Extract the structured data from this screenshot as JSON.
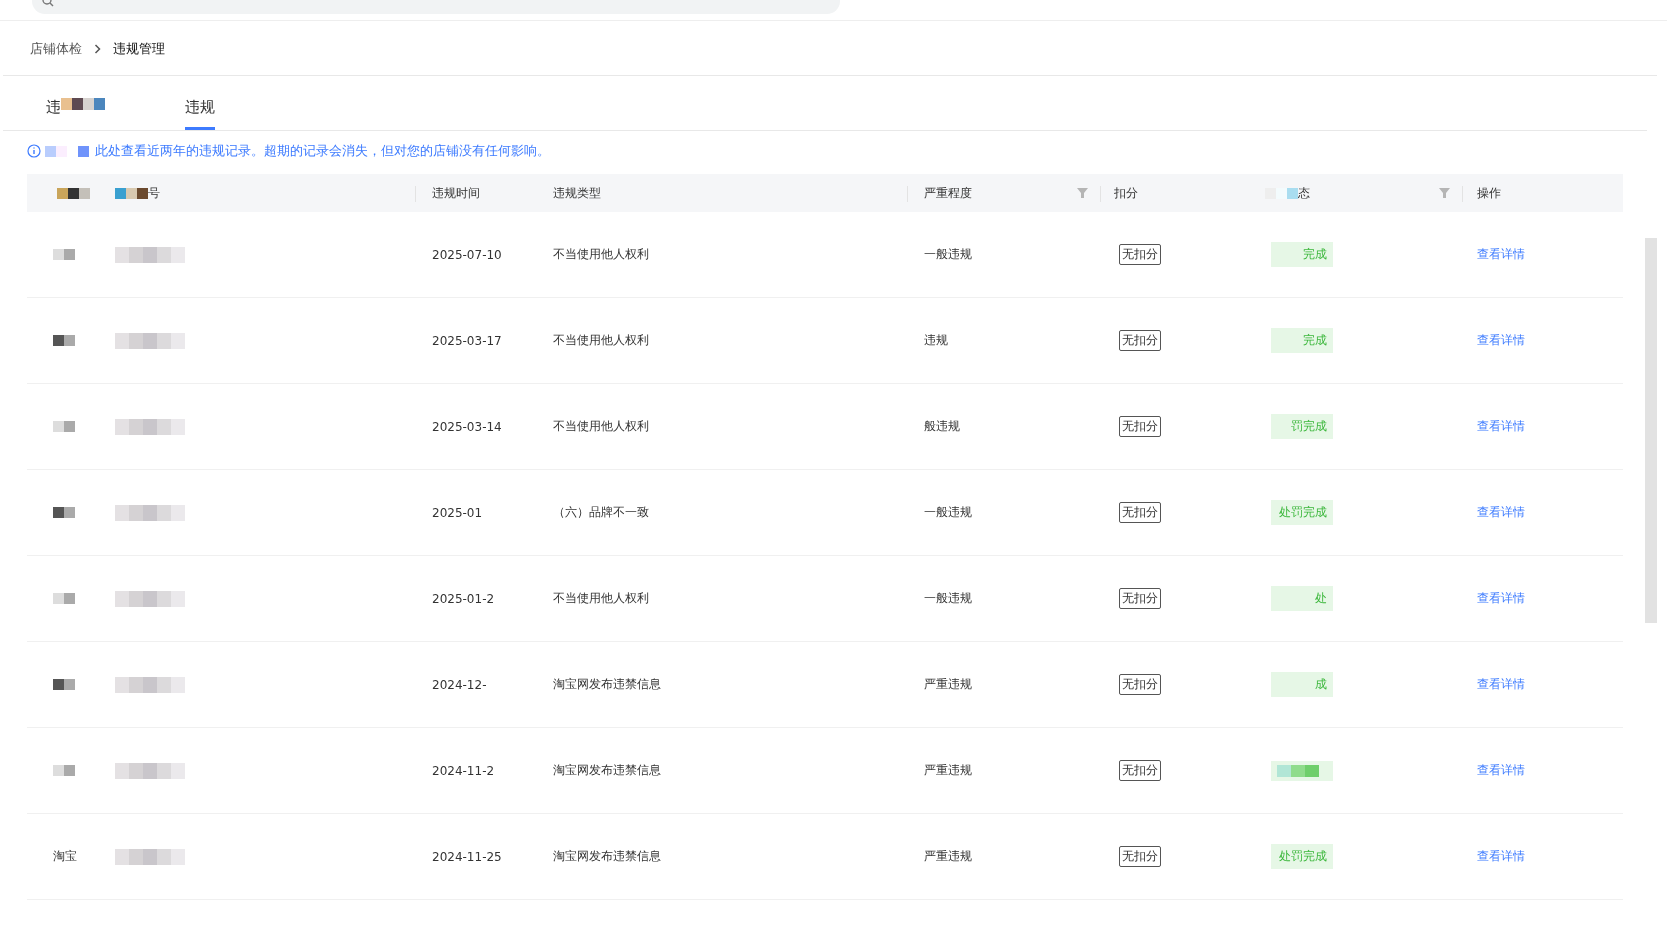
{
  "breadcrumb": [
    "店铺体检",
    "违规管理"
  ],
  "tabs": [
    {
      "label": "违",
      "selected": false
    },
    {
      "label": "违规",
      "selected": true
    }
  ],
  "notice": {
    "text": "此处查看近两年的违规记录。超期的记录会消失，但对您的店铺没有任何影响。"
  },
  "table": {
    "columns": [
      {
        "kind": "redacted"
      },
      {
        "kind": "text",
        "label": "号"
      },
      {
        "kind": "text",
        "label": "违规时间"
      },
      {
        "kind": "text",
        "label": "违规类型"
      },
      {
        "kind": "filter",
        "label": "严重程度"
      },
      {
        "kind": "text",
        "label": "扣分"
      },
      {
        "kind": "filter",
        "label": "态"
      },
      {
        "kind": "text",
        "label": "操作"
      }
    ],
    "rows": [
      {
        "column_1": {
          "kind": "redacted"
        },
        "date": "2025-07-10",
        "type": "不当使用他人权利",
        "severity": "一般违规",
        "deduction": "无扣分",
        "status": "完成",
        "action": "查看详情"
      },
      {
        "column_1": {
          "kind": "redacted"
        },
        "date": "2025-03-17",
        "type": "不当使用他人权利",
        "severity": "违规",
        "deduction": "无扣分",
        "status": "完成",
        "action": "查看详情"
      },
      {
        "column_1": {
          "kind": "redacted"
        },
        "date": "2025-03-14",
        "type": "不当使用他人权利",
        "severity": "般违规",
        "deduction": "无扣分",
        "status": "罚完成",
        "action": "查看详情"
      },
      {
        "column_1": {
          "kind": "redacted"
        },
        "date": "2025-01",
        "type": "（六）品牌不一致",
        "severity": "一般违规",
        "deduction": "无扣分",
        "status": "处罚完成",
        "action": "查看详情"
      },
      {
        "column_1": {
          "kind": "redacted"
        },
        "date": "2025-01-2",
        "type": "不当使用他人权利",
        "severity": "一般违规",
        "deduction": "无扣分",
        "status": "处",
        "action": "查看详情"
      },
      {
        "column_1": {
          "kind": "redacted"
        },
        "date": "2024-12-",
        "type": "淘宝网发布违禁信息",
        "severity": "严重违规",
        "deduction": "无扣分",
        "status": "成",
        "action": "查看详情"
      },
      {
        "column_1": {
          "kind": "redacted"
        },
        "date": "2024-11-2",
        "type": "淘宝网发布违禁信息",
        "severity": "严重违规",
        "deduction": "无扣分",
        "action": "查看详情"
      },
      {
        "column_1": {
          "kind": "text",
          "text": "淘宝"
        },
        "date": "2024-11-25",
        "type": "淘宝网发布违禁信息",
        "severity": "严重违规",
        "deduction": "无扣分",
        "status": "处罚完成",
        "action": "查看详情"
      }
    ]
  }
}
